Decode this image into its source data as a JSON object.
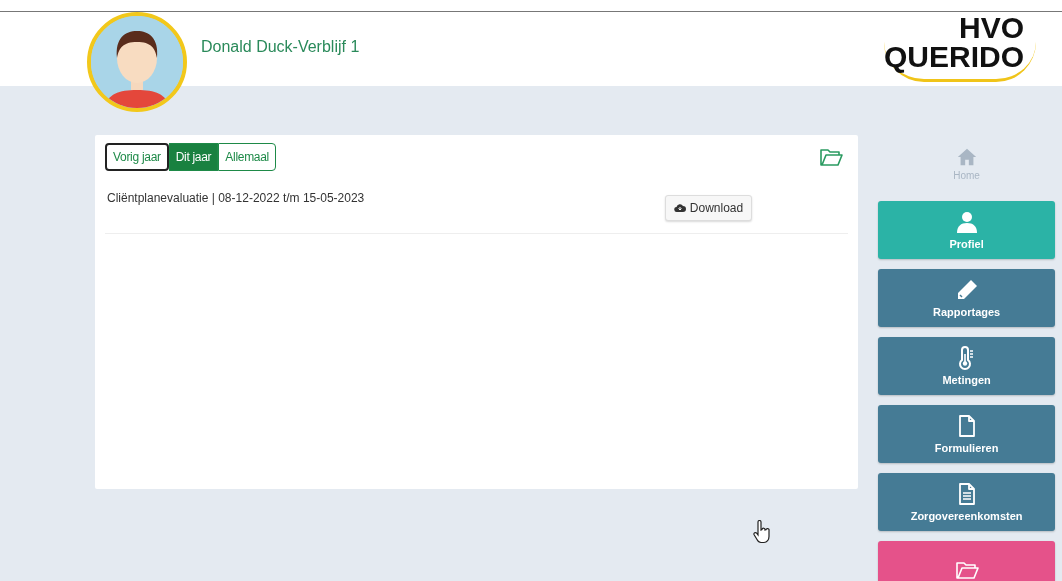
{
  "header": {
    "title": "Donald Duck-Verblijf 1",
    "logo": {
      "line_1": "HVO",
      "line_2": "QUERIDO"
    }
  },
  "filter_tabs": [
    {
      "label": "Vorig jaar",
      "selected": false,
      "focused": true
    },
    {
      "label": "Dit jaar",
      "selected": true,
      "focused": false
    },
    {
      "label": "Allemaal",
      "selected": false,
      "focused": false
    }
  ],
  "documents": [
    {
      "title": "Cliëntplanevaluatie | 08-12-2022 t/m 15-05-2023",
      "button": "Download"
    }
  ],
  "nav": [
    {
      "kind": "plain",
      "label": "Home"
    },
    {
      "kind": "tile",
      "label": "Profiel",
      "color": "#2bb3a6"
    },
    {
      "kind": "tile",
      "label": "Rapportages",
      "color": "#457b95"
    },
    {
      "kind": "tile",
      "label": "Metingen",
      "color": "#457b95"
    },
    {
      "kind": "tile",
      "label": "Formulieren",
      "color": "#457b95"
    },
    {
      "kind": "tile",
      "label": "Zorgovereenkomsten",
      "color": "#457b95"
    },
    {
      "kind": "tile",
      "color": "#e5528a"
    }
  ]
}
